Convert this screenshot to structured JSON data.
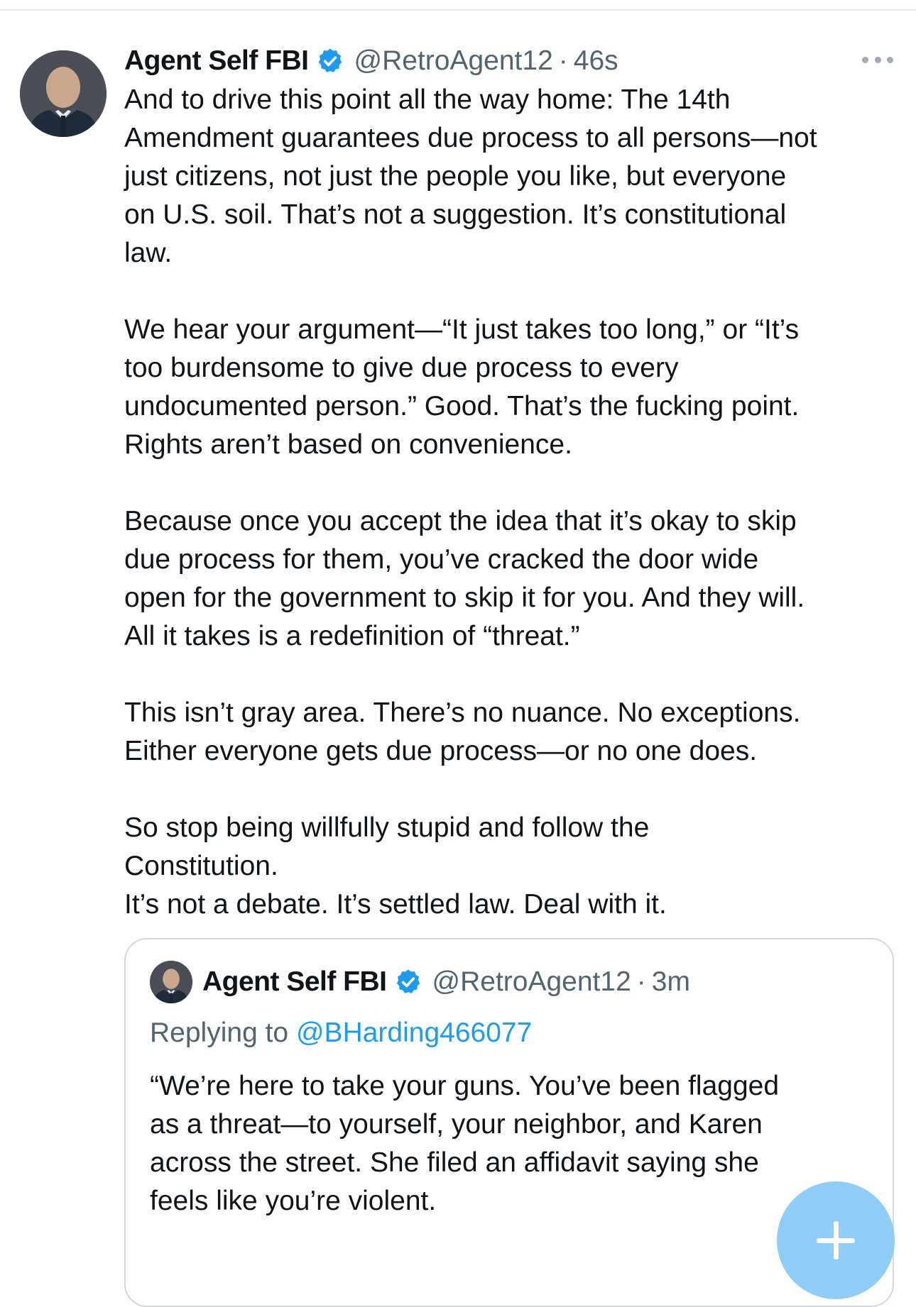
{
  "post": {
    "author": {
      "display_name": "Agent Self FBI",
      "handle": "@RetroAgent12",
      "verified": true,
      "avatar_icon": "profile-photo"
    },
    "separator": "·",
    "time": "46s",
    "more_icon": "more-horizontal-icon",
    "paragraphs": [
      "And to drive this point all the way home: The 14th\nAmendment guarantees due process to all persons—not\njust citizens, not just the people you like, but everyone\non U.S. soil. That’s not a suggestion. It’s constitutional\nlaw.",
      "We hear your argument—“It just takes too long,” or “It’s\ntoo burdensome to give due process to every\nundocumented person.” Good. That’s the fucking point.\nRights aren’t based on convenience.",
      "Because once you accept the idea that it’s okay to skip\ndue process for them, you’ve cracked the door wide\nopen for the government to skip it for you. And they will.\nAll it takes is a redefinition of “threat.”",
      "This isn’t gray area. There’s no nuance. No exceptions.\nEither everyone gets due process—or no one does.",
      "So stop being willfully stupid and follow the\nConstitution.\nIt’s not a debate. It’s settled law. Deal with it."
    ]
  },
  "quoted_post": {
    "author": {
      "display_name": "Agent Self FBI",
      "handle": "@RetroAgent12",
      "verified": true
    },
    "separator": "·",
    "time": "3m",
    "replying_to_label": "Replying to",
    "replying_to_handle": "@BHarding466077",
    "text": "“We’re here to take your guns. You’ve been flagged\nas a threat—to yourself, your neighbor, and Karen\nacross the street. She filed an affidavit saying she\nfeels like you’re violent."
  },
  "fab": {
    "icon": "plus-icon"
  },
  "colors": {
    "accent": "#1d9bf0",
    "text_primary": "#0f1419",
    "text_secondary": "#536471",
    "border": "#cfd9de",
    "fab": "#8fcdf6"
  }
}
